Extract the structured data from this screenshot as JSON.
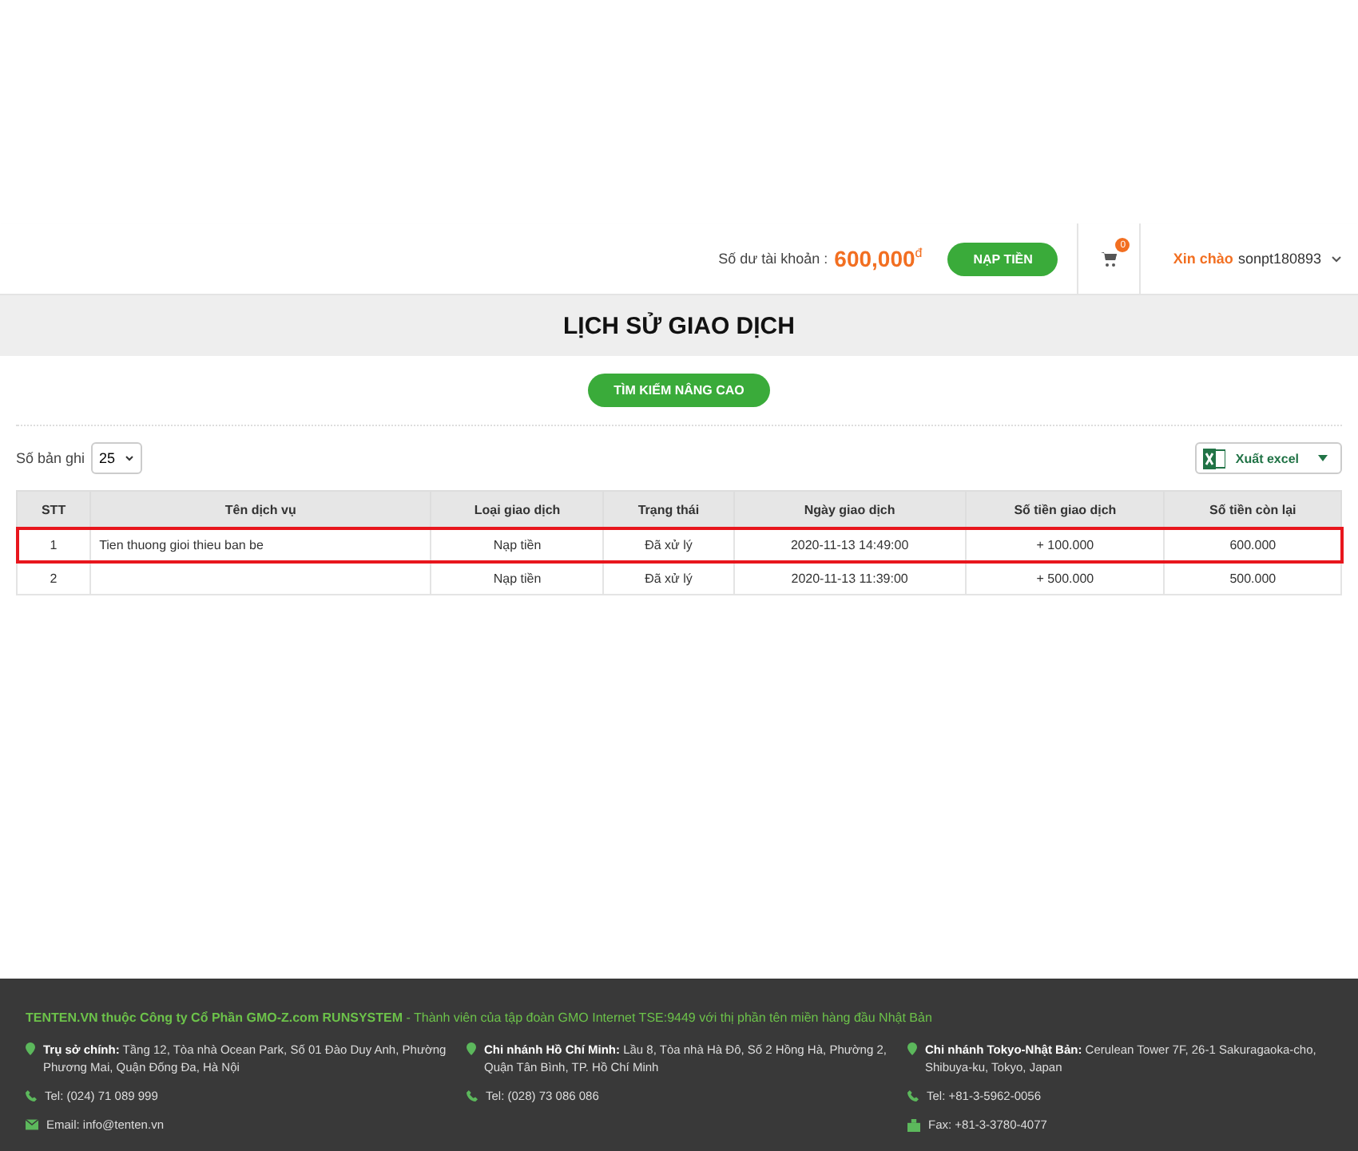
{
  "header": {
    "balance_label": "Số dư tài khoản :",
    "balance": "600,000",
    "currency": "đ",
    "topup_button": "NẠP TIỀN",
    "cart_count": "0",
    "greeting": "Xin chào",
    "username": "sonpt180893"
  },
  "page_title": "LỊCH SỬ GIAO DỊCH",
  "search_button": "TÌM KIẾM NÂNG CAO",
  "page_size": {
    "label": "Số bản ghi",
    "value": "25"
  },
  "export_button": "Xuất excel",
  "table": {
    "columns": [
      "STT",
      "Tên dịch vụ",
      "Loại giao dịch",
      "Trạng thái",
      "Ngày giao dịch",
      "Số tiền giao dịch",
      "Số tiền còn lại"
    ],
    "rows": [
      {
        "cells": [
          "1",
          "Tien thuong gioi thieu ban be",
          "Nạp tiền",
          "Đã xử lý",
          "2020-11-13 14:49:00",
          "+ 100.000",
          "600.000"
        ],
        "highlighted": true
      },
      {
        "cells": [
          "2",
          "",
          "Nạp tiền",
          "Đã xử lý",
          "2020-11-13 11:39:00",
          "+ 500.000",
          "500.000"
        ],
        "highlighted": false
      }
    ]
  },
  "footer": {
    "company": "TENTEN.VN thuộc Công ty Cổ Phần GMO-Z.com RUNSYSTEM",
    "tagline": "- Thành viên của tập đoàn GMO Internet TSE:9449 với thị phần tên miền hàng đầu Nhật Bản",
    "offices": [
      {
        "title": "Trụ sở chính:",
        "address": "Tầng 12, Tòa nhà Ocean Park, Số 01 Đào Duy Anh, Phường Phương Mai, Quận Đống Đa, Hà Nội",
        "contacts": [
          {
            "kind": "phone",
            "text": "Tel: (024) 71 089 999"
          },
          {
            "kind": "email",
            "text": "Email: info@tenten.vn"
          }
        ]
      },
      {
        "title": "Chi nhánh Hồ Chí Minh:",
        "address": "Lầu 8, Tòa nhà Hà Đô, Số 2 Hồng Hà, Phường 2, Quận Tân Bình, TP. Hồ Chí Minh",
        "contacts": [
          {
            "kind": "phone",
            "text": "Tel: (028) 73 086 086"
          }
        ]
      },
      {
        "title": "Chi nhánh Tokyo-Nhật Bản:",
        "address": "Cerulean Tower 7F, 26-1 Sakuragaoka-cho, Shibuya-ku, Tokyo, Japan",
        "contacts": [
          {
            "kind": "phone",
            "text": "Tel: +81-3-5962-0056"
          },
          {
            "kind": "fax",
            "text": "Fax: +81-3-3780-4077"
          }
        ]
      }
    ]
  }
}
